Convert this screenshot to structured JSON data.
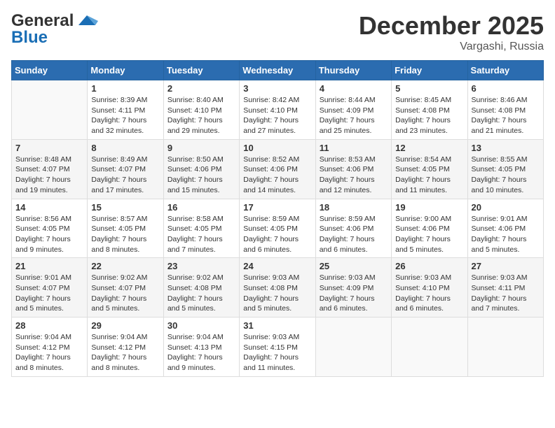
{
  "header": {
    "logo_line1": "General",
    "logo_line2": "Blue",
    "month": "December 2025",
    "location": "Vargashi, Russia"
  },
  "weekdays": [
    "Sunday",
    "Monday",
    "Tuesday",
    "Wednesday",
    "Thursday",
    "Friday",
    "Saturday"
  ],
  "weeks": [
    [
      {
        "day": "",
        "sunrise": "",
        "sunset": "",
        "daylight": ""
      },
      {
        "day": "1",
        "sunrise": "Sunrise: 8:39 AM",
        "sunset": "Sunset: 4:11 PM",
        "daylight": "Daylight: 7 hours and 32 minutes."
      },
      {
        "day": "2",
        "sunrise": "Sunrise: 8:40 AM",
        "sunset": "Sunset: 4:10 PM",
        "daylight": "Daylight: 7 hours and 29 minutes."
      },
      {
        "day": "3",
        "sunrise": "Sunrise: 8:42 AM",
        "sunset": "Sunset: 4:10 PM",
        "daylight": "Daylight: 7 hours and 27 minutes."
      },
      {
        "day": "4",
        "sunrise": "Sunrise: 8:44 AM",
        "sunset": "Sunset: 4:09 PM",
        "daylight": "Daylight: 7 hours and 25 minutes."
      },
      {
        "day": "5",
        "sunrise": "Sunrise: 8:45 AM",
        "sunset": "Sunset: 4:08 PM",
        "daylight": "Daylight: 7 hours and 23 minutes."
      },
      {
        "day": "6",
        "sunrise": "Sunrise: 8:46 AM",
        "sunset": "Sunset: 4:08 PM",
        "daylight": "Daylight: 7 hours and 21 minutes."
      }
    ],
    [
      {
        "day": "7",
        "sunrise": "Sunrise: 8:48 AM",
        "sunset": "Sunset: 4:07 PM",
        "daylight": "Daylight: 7 hours and 19 minutes."
      },
      {
        "day": "8",
        "sunrise": "Sunrise: 8:49 AM",
        "sunset": "Sunset: 4:07 PM",
        "daylight": "Daylight: 7 hours and 17 minutes."
      },
      {
        "day": "9",
        "sunrise": "Sunrise: 8:50 AM",
        "sunset": "Sunset: 4:06 PM",
        "daylight": "Daylight: 7 hours and 15 minutes."
      },
      {
        "day": "10",
        "sunrise": "Sunrise: 8:52 AM",
        "sunset": "Sunset: 4:06 PM",
        "daylight": "Daylight: 7 hours and 14 minutes."
      },
      {
        "day": "11",
        "sunrise": "Sunrise: 8:53 AM",
        "sunset": "Sunset: 4:06 PM",
        "daylight": "Daylight: 7 hours and 12 minutes."
      },
      {
        "day": "12",
        "sunrise": "Sunrise: 8:54 AM",
        "sunset": "Sunset: 4:05 PM",
        "daylight": "Daylight: 7 hours and 11 minutes."
      },
      {
        "day": "13",
        "sunrise": "Sunrise: 8:55 AM",
        "sunset": "Sunset: 4:05 PM",
        "daylight": "Daylight: 7 hours and 10 minutes."
      }
    ],
    [
      {
        "day": "14",
        "sunrise": "Sunrise: 8:56 AM",
        "sunset": "Sunset: 4:05 PM",
        "daylight": "Daylight: 7 hours and 9 minutes."
      },
      {
        "day": "15",
        "sunrise": "Sunrise: 8:57 AM",
        "sunset": "Sunset: 4:05 PM",
        "daylight": "Daylight: 7 hours and 8 minutes."
      },
      {
        "day": "16",
        "sunrise": "Sunrise: 8:58 AM",
        "sunset": "Sunset: 4:05 PM",
        "daylight": "Daylight: 7 hours and 7 minutes."
      },
      {
        "day": "17",
        "sunrise": "Sunrise: 8:59 AM",
        "sunset": "Sunset: 4:05 PM",
        "daylight": "Daylight: 7 hours and 6 minutes."
      },
      {
        "day": "18",
        "sunrise": "Sunrise: 8:59 AM",
        "sunset": "Sunset: 4:06 PM",
        "daylight": "Daylight: 7 hours and 6 minutes."
      },
      {
        "day": "19",
        "sunrise": "Sunrise: 9:00 AM",
        "sunset": "Sunset: 4:06 PM",
        "daylight": "Daylight: 7 hours and 5 minutes."
      },
      {
        "day": "20",
        "sunrise": "Sunrise: 9:01 AM",
        "sunset": "Sunset: 4:06 PM",
        "daylight": "Daylight: 7 hours and 5 minutes."
      }
    ],
    [
      {
        "day": "21",
        "sunrise": "Sunrise: 9:01 AM",
        "sunset": "Sunset: 4:07 PM",
        "daylight": "Daylight: 7 hours and 5 minutes."
      },
      {
        "day": "22",
        "sunrise": "Sunrise: 9:02 AM",
        "sunset": "Sunset: 4:07 PM",
        "daylight": "Daylight: 7 hours and 5 minutes."
      },
      {
        "day": "23",
        "sunrise": "Sunrise: 9:02 AM",
        "sunset": "Sunset: 4:08 PM",
        "daylight": "Daylight: 7 hours and 5 minutes."
      },
      {
        "day": "24",
        "sunrise": "Sunrise: 9:03 AM",
        "sunset": "Sunset: 4:08 PM",
        "daylight": "Daylight: 7 hours and 5 minutes."
      },
      {
        "day": "25",
        "sunrise": "Sunrise: 9:03 AM",
        "sunset": "Sunset: 4:09 PM",
        "daylight": "Daylight: 7 hours and 6 minutes."
      },
      {
        "day": "26",
        "sunrise": "Sunrise: 9:03 AM",
        "sunset": "Sunset: 4:10 PM",
        "daylight": "Daylight: 7 hours and 6 minutes."
      },
      {
        "day": "27",
        "sunrise": "Sunrise: 9:03 AM",
        "sunset": "Sunset: 4:11 PM",
        "daylight": "Daylight: 7 hours and 7 minutes."
      }
    ],
    [
      {
        "day": "28",
        "sunrise": "Sunrise: 9:04 AM",
        "sunset": "Sunset: 4:12 PM",
        "daylight": "Daylight: 7 hours and 8 minutes."
      },
      {
        "day": "29",
        "sunrise": "Sunrise: 9:04 AM",
        "sunset": "Sunset: 4:12 PM",
        "daylight": "Daylight: 7 hours and 8 minutes."
      },
      {
        "day": "30",
        "sunrise": "Sunrise: 9:04 AM",
        "sunset": "Sunset: 4:13 PM",
        "daylight": "Daylight: 7 hours and 9 minutes."
      },
      {
        "day": "31",
        "sunrise": "Sunrise: 9:03 AM",
        "sunset": "Sunset: 4:15 PM",
        "daylight": "Daylight: 7 hours and 11 minutes."
      },
      {
        "day": "",
        "sunrise": "",
        "sunset": "",
        "daylight": ""
      },
      {
        "day": "",
        "sunrise": "",
        "sunset": "",
        "daylight": ""
      },
      {
        "day": "",
        "sunrise": "",
        "sunset": "",
        "daylight": ""
      }
    ]
  ]
}
